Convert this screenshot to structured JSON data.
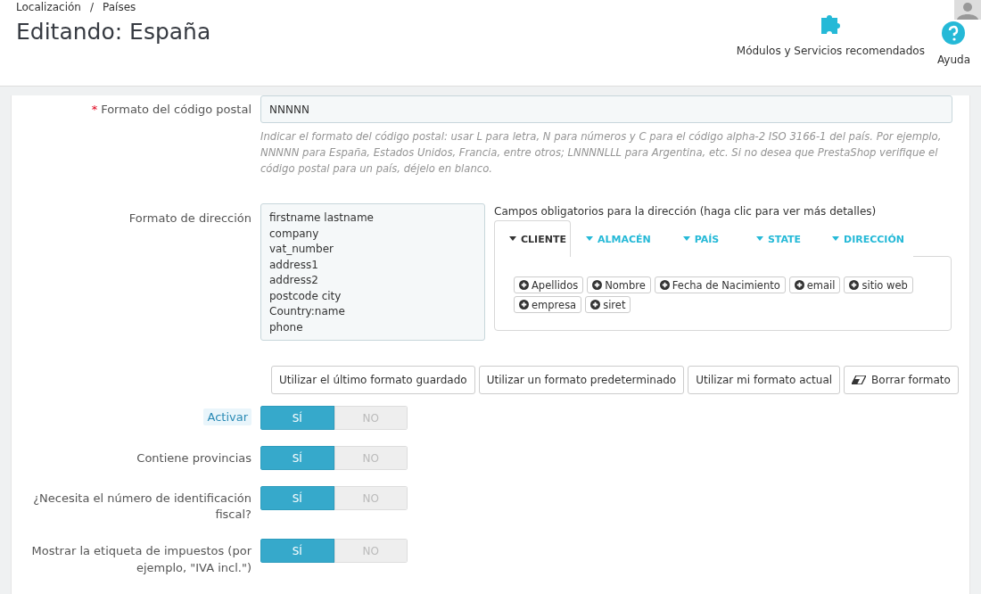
{
  "breadcrumb": [
    "Localización",
    "Países"
  ],
  "breadcrumb_separator": "/",
  "title": "Editando: España",
  "toolbar": [
    {
      "kind": "modules",
      "label": "Módulos y Servicios recomendados"
    },
    {
      "kind": "help",
      "label": "Ayuda"
    }
  ],
  "postcode": {
    "label": "Formato del código postal",
    "required": true,
    "required_mark": "*",
    "value": "NNNNN",
    "help": "Indicar el formato del código postal: usar L para letra, N para números y C para el código alpha-2 ISO 3166-1 del país. Por ejemplo, NNNNN para España, Estados Unidos, Francia, entre otros; LNNNNLLL para Argentina, etc. Si no desea que PrestaShop verifique el código postal para un país, déjelo en blanco."
  },
  "address_format": {
    "label": "Formato de dirección",
    "lines": [
      "firstname lastname",
      "company",
      "vat_number",
      "address1",
      "address2",
      "postcode city",
      "Country:name",
      "phone"
    ],
    "fields_title": "Campos obligatorios para la dirección (haga clic para ver más detalles)",
    "tabs": [
      {
        "label": "CLIENTE",
        "selected": true
      },
      {
        "label": "ALMACÉN",
        "selected": false
      },
      {
        "label": "PAÍS",
        "selected": false
      },
      {
        "label": "STATE",
        "selected": false
      },
      {
        "label": "DIRECCIÓN",
        "selected": false
      }
    ],
    "chips": [
      "Apellidos",
      "Nombre",
      "Fecha de Nacimiento",
      "email",
      "sitio web",
      "empresa",
      "siret"
    ],
    "buttons": [
      {
        "kind": "plain",
        "label": "Utilizar el último formato guardado"
      },
      {
        "kind": "plain",
        "label": "Utilizar un formato predeterminado"
      },
      {
        "kind": "plain",
        "label": "Utilizar mi formato actual"
      },
      {
        "kind": "eraser",
        "label": "Borrar formato"
      }
    ]
  },
  "switches": [
    {
      "label": "Activar",
      "highlighted": true,
      "on": true,
      "yes": "SÍ",
      "no": "NO"
    },
    {
      "label": "Contiene provincias",
      "highlighted": false,
      "on": true,
      "yes": "SÍ",
      "no": "NO"
    },
    {
      "label": "¿Necesita el número de identificación fiscal?",
      "highlighted": false,
      "on": true,
      "yes": "SÍ",
      "no": "NO"
    },
    {
      "label": "Mostrar la etiqueta de impuestos (por ejemplo, \"IVA incl.\")",
      "highlighted": false,
      "on": true,
      "yes": "SÍ",
      "no": "NO"
    }
  ]
}
